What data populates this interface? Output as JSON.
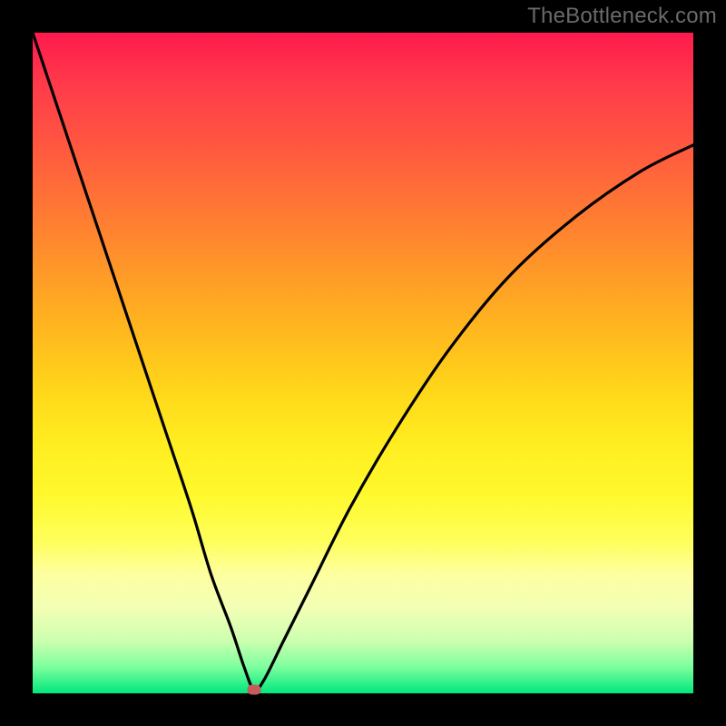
{
  "watermark": "TheBottleneck.com",
  "colors": {
    "frame": "#000000",
    "curve": "#000000",
    "marker": "#c75c5c",
    "gradient_top": "#ff1a4d",
    "gradient_mid": "#ffff5c",
    "gradient_bottom": "#00e77d"
  },
  "chart_data": {
    "type": "line",
    "title": "",
    "xlabel": "",
    "ylabel": "",
    "xlim": [
      0,
      100
    ],
    "ylim": [
      0,
      100
    ],
    "grid": false,
    "legend": false,
    "series": [
      {
        "name": "bottleneck-curve",
        "x": [
          0,
          4,
          8,
          12,
          16,
          20,
          24,
          27,
          30,
          32,
          33.5,
          35,
          38,
          42,
          48,
          55,
          63,
          72,
          82,
          92,
          100
        ],
        "y": [
          100,
          88,
          76,
          64,
          52,
          40,
          28,
          18,
          10,
          4,
          0.5,
          2,
          8,
          16,
          28,
          40,
          52,
          63,
          72,
          79,
          83
        ]
      }
    ],
    "marker": {
      "x": 33.5,
      "y": 0.5
    },
    "annotations": []
  }
}
